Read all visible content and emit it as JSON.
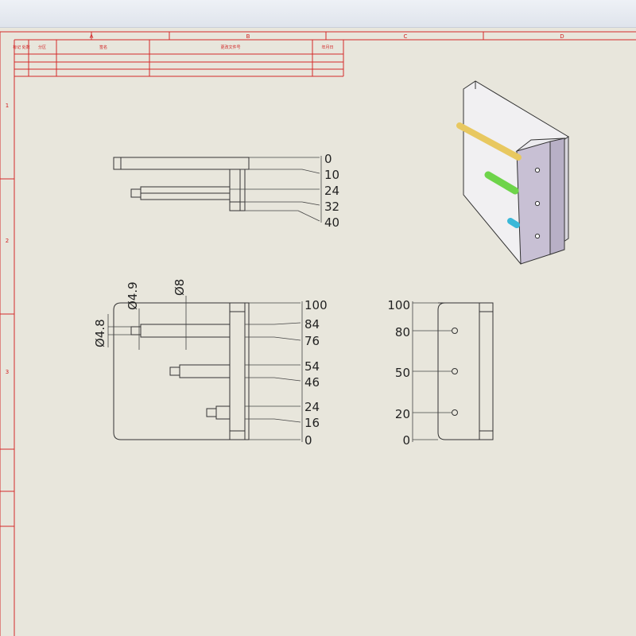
{
  "frame": {
    "col_labels": [
      "A",
      "B",
      "C",
      "D"
    ],
    "row_labels": [
      "1",
      "2",
      "3"
    ],
    "color": "#d42a2a"
  },
  "title_block": {
    "c1": "标记 处数",
    "c2": "分区",
    "c3": "更改文件号",
    "c4": "签名",
    "c5": "年月日"
  },
  "front_view": {
    "dims": [
      "0",
      "10",
      "24",
      "32",
      "40"
    ]
  },
  "top_view": {
    "dims": [
      "100",
      "84",
      "76",
      "54",
      "46",
      "24",
      "16",
      "0"
    ],
    "dia_small": "Ø4.8",
    "dia_tip": "Ø4.9",
    "dia_body": "Ø8"
  },
  "side_view": {
    "dims": [
      "100",
      "80",
      "50",
      "20",
      "0"
    ]
  },
  "iso_view": {
    "pin_colors": [
      "#e8c860",
      "#6ed44a",
      "#3ab8d8"
    ],
    "plate_color": "#f1f0f2"
  }
}
